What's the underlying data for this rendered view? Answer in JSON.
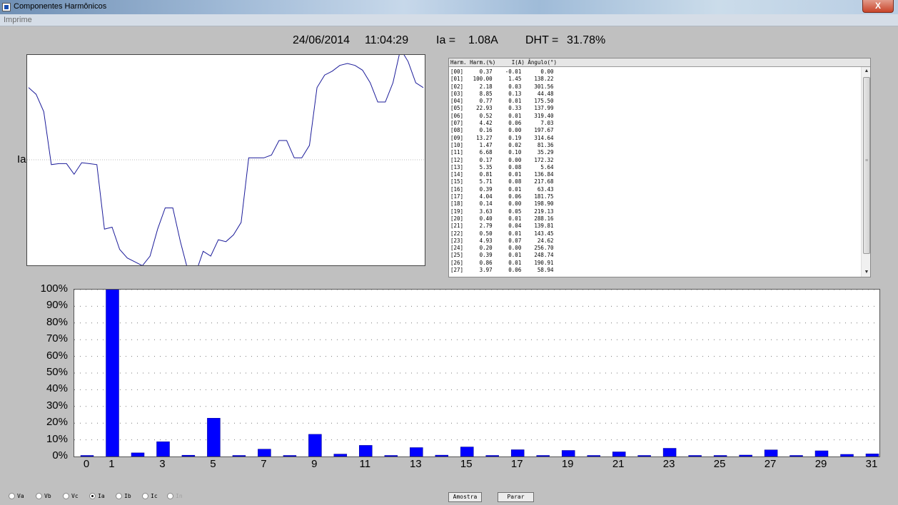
{
  "window": {
    "title": "Componentes Harmônicos",
    "close_label": "X"
  },
  "menu": {
    "items": [
      "Imprime"
    ]
  },
  "header": {
    "date": "24/06/2014",
    "time": "11:04:29",
    "current_label": "Ia =",
    "current_value": "1.08A",
    "dht_label": "DHT =",
    "dht_value": "31.78%"
  },
  "waveform": {
    "channel_label": "Ia",
    "samples": [
      0.75,
      0.68,
      0.5,
      -0.05,
      -0.04,
      -0.04,
      -0.15,
      -0.03,
      -0.04,
      -0.05,
      -0.72,
      -0.7,
      -0.93,
      -1.02,
      -1.06,
      -1.1,
      -1.0,
      -0.72,
      -0.5,
      -0.5,
      -0.85,
      -1.15,
      -1.18,
      -0.95,
      -1.0,
      -0.83,
      -0.85,
      -0.78,
      -0.65,
      0.02,
      0.02,
      0.02,
      0.05,
      0.2,
      0.2,
      0.02,
      0.02,
      0.15,
      0.75,
      0.88,
      0.92,
      0.98,
      1.0,
      0.98,
      0.93,
      0.8,
      0.6,
      0.6,
      0.8,
      1.15,
      1.02,
      0.8,
      0.75
    ]
  },
  "table": {
    "header": "Harm. Harm.(%)     I(A) Ângulo(°)",
    "rows": [
      "[00]     0.37    -0.01      0.00",
      "[01]   100.00     1.45    138.22",
      "[02]     2.18     0.03    301.56",
      "[03]     8.85     0.13     44.48",
      "[04]     0.77     0.01    175.50",
      "[05]    22.93     0.33    137.99",
      "[06]     0.52     0.01    319.40",
      "[07]     4.42     0.06      7.03",
      "[08]     0.16     0.00    197.67",
      "[09]    13.27     0.19    314.64",
      "[10]     1.47     0.02     81.36",
      "[11]     6.68     0.10     35.29",
      "[12]     0.17     0.00    172.32",
      "[13]     5.35     0.08      5.64",
      "[14]     0.81     0.01    136.84",
      "[15]     5.71     0.08    217.68",
      "[16]     0.39     0.01     63.43",
      "[17]     4.04     0.06    181.75",
      "[18]     0.14     0.00    198.90",
      "[19]     3.63     0.05    219.13",
      "[20]     0.40     0.01    288.16",
      "[21]     2.79     0.04    139.81",
      "[22]     0.50     0.01    143.45",
      "[23]     4.93     0.07     24.62",
      "[24]     0.20     0.00    256.70",
      "[25]     0.39     0.01    248.74",
      "[26]     0.86     0.01    190.91",
      "[27]     3.97     0.06     58.94"
    ]
  },
  "chart_data": {
    "type": "bar",
    "categories": [
      "0",
      "1",
      "2",
      "3",
      "4",
      "5",
      "6",
      "7",
      "8",
      "9",
      "10",
      "11",
      "12",
      "13",
      "14",
      "15",
      "16",
      "17",
      "18",
      "19",
      "20",
      "21",
      "22",
      "23",
      "24",
      "25",
      "26",
      "27",
      "28",
      "29",
      "30",
      "31"
    ],
    "values": [
      0.37,
      100.0,
      2.18,
      8.85,
      0.77,
      22.93,
      0.52,
      4.42,
      0.16,
      13.27,
      1.47,
      6.68,
      0.17,
      5.35,
      0.81,
      5.71,
      0.39,
      4.04,
      0.14,
      3.63,
      0.4,
      2.79,
      0.5,
      4.93,
      0.2,
      0.39,
      0.86,
      3.97,
      0.25,
      3.4,
      1.3,
      1.6
    ],
    "x_tick_labels": [
      "0",
      "1",
      "3",
      "5",
      "7",
      "9",
      "11",
      "13",
      "15",
      "17",
      "19",
      "21",
      "23",
      "25",
      "27",
      "29",
      "31"
    ],
    "y_tick_labels": [
      "0%",
      "10%",
      "20%",
      "30%",
      "40%",
      "50%",
      "60%",
      "70%",
      "80%",
      "90%",
      "100%"
    ],
    "ylim": [
      0,
      100
    ],
    "grid": true,
    "bar_color": "#0000ff"
  },
  "controls": {
    "radios": [
      {
        "label": "Va",
        "checked": false,
        "disabled": false
      },
      {
        "label": "Vb",
        "checked": false,
        "disabled": false
      },
      {
        "label": "Vc",
        "checked": false,
        "disabled": false
      },
      {
        "label": "Ia",
        "checked": true,
        "disabled": false
      },
      {
        "label": "Ib",
        "checked": false,
        "disabled": false
      },
      {
        "label": "Ic",
        "checked": false,
        "disabled": false
      },
      {
        "label": "In",
        "checked": false,
        "disabled": true
      }
    ],
    "sample_button": "Amostra",
    "stop_button": "Parar"
  }
}
